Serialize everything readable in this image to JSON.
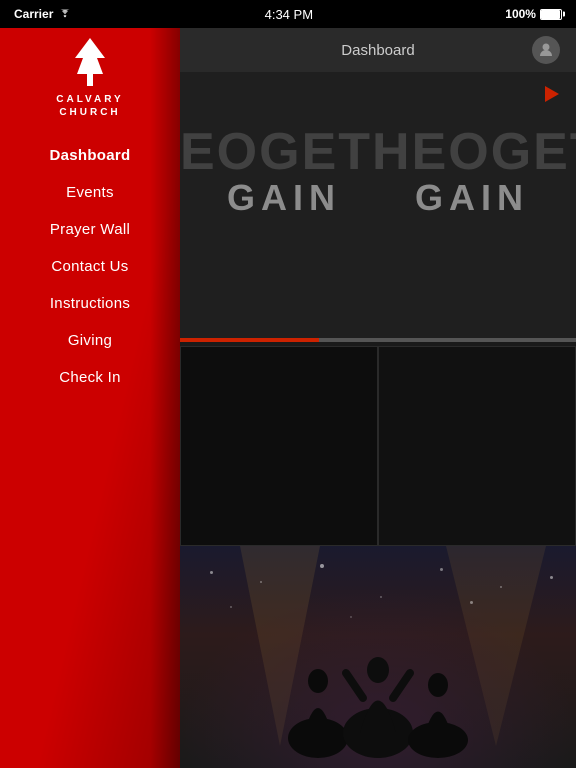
{
  "status_bar": {
    "carrier": "Carrier",
    "time": "4:34 PM",
    "battery": "100%"
  },
  "header": {
    "title": "Dashboard",
    "avatar_label": "👤"
  },
  "sidebar": {
    "logo_line1": "CALVARY",
    "logo_line2": "CHURCH",
    "nav_items": [
      {
        "id": "dashboard",
        "label": "Dashboard",
        "active": true
      },
      {
        "id": "events",
        "label": "Events",
        "active": false
      },
      {
        "id": "prayer-wall",
        "label": "Prayer Wall",
        "active": false
      },
      {
        "id": "contact-us",
        "label": "Contact Us",
        "active": false
      },
      {
        "id": "instructions",
        "label": "Instructions",
        "active": false
      },
      {
        "id": "giving",
        "label": "Giving",
        "active": false
      },
      {
        "id": "check-in",
        "label": "Check In",
        "active": false
      }
    ]
  },
  "hero": {
    "bg_text": "EOGETHEOGETHEO",
    "gain_text_1": "GAIN",
    "gain_text_2": "GAIN"
  },
  "icons": {
    "play": "▶",
    "user": "●"
  }
}
